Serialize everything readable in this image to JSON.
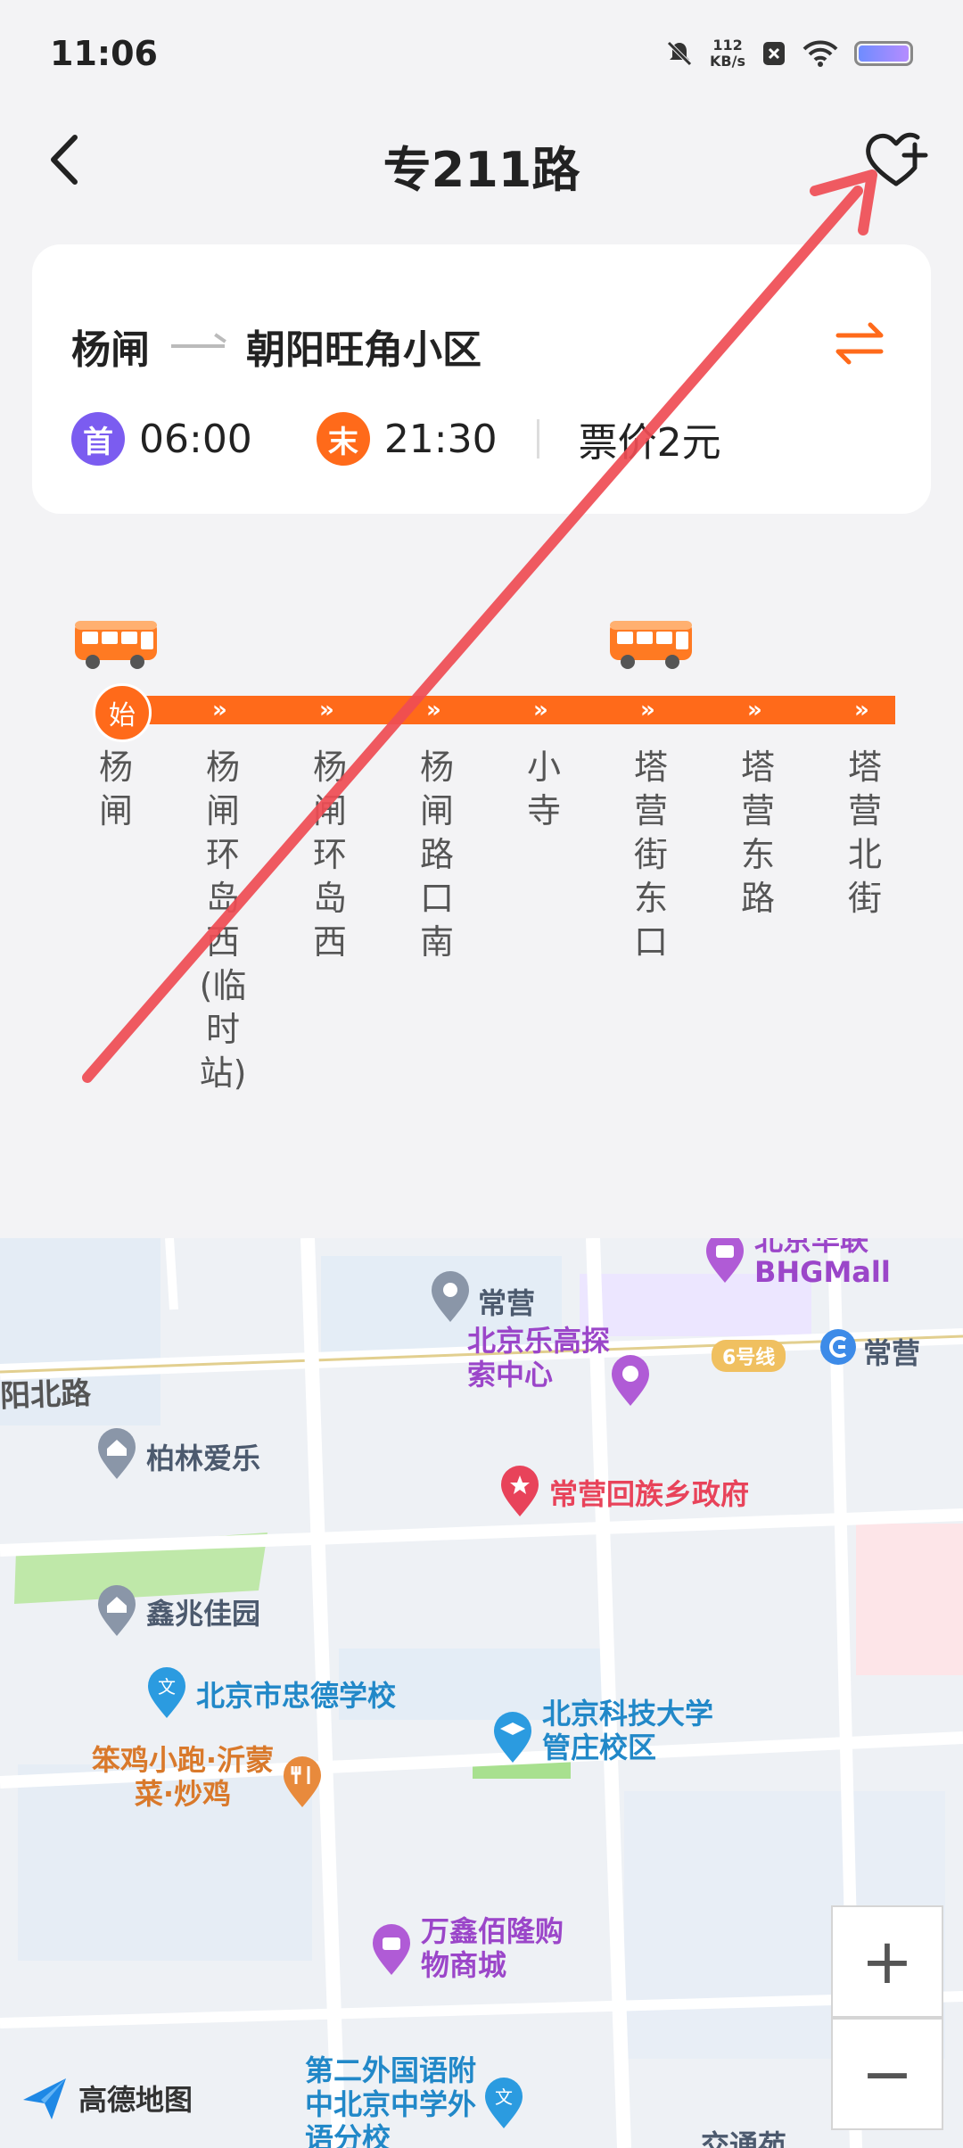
{
  "status": {
    "time": "11:06",
    "net_value": "112",
    "net_unit": "KB/s"
  },
  "header": {
    "title": "专211路"
  },
  "route_info": {
    "from": "杨闸",
    "to": "朝阳旺角小区",
    "first_badge": "首",
    "first_time": "06:00",
    "last_badge": "末",
    "last_time": "21:30",
    "fare": "票价2元"
  },
  "route_line": {
    "start_badge": "始",
    "chevron": "»",
    "stops": [
      "杨闸",
      "杨闸环岛西(临时站)",
      "杨闸环岛西",
      "杨闸路口南",
      "小寺",
      "塔营街东口",
      "塔营东路",
      "塔营北街"
    ]
  },
  "map": {
    "labels": {
      "changying": "常营",
      "bhg": "北京华联BHGMall",
      "line6": "6号线",
      "changying_station": "常营",
      "road": "阳北路",
      "explore": "北京乐高探索中心",
      "bolin": "柏林爱乐",
      "gov": "常营回族乡政府",
      "xinzhao": "鑫兆佳园",
      "school": "北京市忠德学校",
      "univ": "北京科技大学管庄校区",
      "restaurant": "笨鸡小跑·沂蒙菜·炒鸡",
      "mall": "万鑫佰隆购物商城",
      "school2": "第二外国语附中北京中学外语分校",
      "partial": "交通苑"
    },
    "zoom_in": "+",
    "zoom_out": "−",
    "logo": "高德地图"
  },
  "colors": {
    "accent": "#ff6a1a",
    "first_badge": "#7b5cf0",
    "annotation": "#ef4d54"
  }
}
